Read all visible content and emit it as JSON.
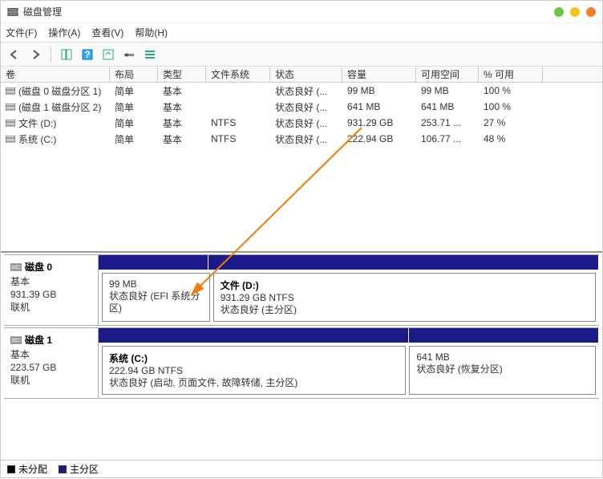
{
  "title": "磁盘管理",
  "menus": {
    "file": "文件(F)",
    "action": "操作(A)",
    "view": "查看(V)",
    "help": "帮助(H)"
  },
  "columns": {
    "volume": "卷",
    "layout": "布局",
    "type": "类型",
    "fs": "文件系统",
    "status": "状态",
    "capacity": "容量",
    "free": "可用空间",
    "pct": "% 可用"
  },
  "volumes": [
    {
      "name": "(磁盘 0 磁盘分区 1)",
      "layout": "简单",
      "type": "基本",
      "fs": "",
      "status": "状态良好 (...",
      "capacity": "99 MB",
      "free": "99 MB",
      "pct": "100 %"
    },
    {
      "name": "(磁盘 1 磁盘分区 2)",
      "layout": "简单",
      "type": "基本",
      "fs": "",
      "status": "状态良好 (...",
      "capacity": "641 MB",
      "free": "641 MB",
      "pct": "100 %"
    },
    {
      "name": "文件 (D:)",
      "layout": "简单",
      "type": "基本",
      "fs": "NTFS",
      "status": "状态良好 (...",
      "capacity": "931.29 GB",
      "free": "253.71 ...",
      "pct": "27 %"
    },
    {
      "name": "系统 (C:)",
      "layout": "简单",
      "type": "基本",
      "fs": "NTFS",
      "status": "状态良好 (...",
      "capacity": "222.94 GB",
      "free": "106.77 ...",
      "pct": "48 %"
    }
  ],
  "disks": [
    {
      "name": "磁盘 0",
      "type": "基本",
      "size": "931.39 GB",
      "status": "联机",
      "parts": [
        {
          "title": "",
          "size": "99 MB",
          "detail": "状态良好 (EFI 系统分区)",
          "widthPct": 22
        },
        {
          "title": "文件  (D:)",
          "size": "931.29 GB NTFS",
          "detail": "状态良好 (主分区)",
          "widthPct": 78
        }
      ]
    },
    {
      "name": "磁盘 1",
      "type": "基本",
      "size": "223.57 GB",
      "status": "联机",
      "parts": [
        {
          "title": "系统  (C:)",
          "size": "222.94 GB NTFS",
          "detail": "状态良好 (启动, 页面文件, 故障转储, 主分区)",
          "widthPct": 62
        },
        {
          "title": "",
          "size": "641 MB",
          "detail": "状态良好 (恢复分区)",
          "widthPct": 38
        }
      ]
    }
  ],
  "legend": {
    "unalloc": "未分配",
    "primary": "主分区"
  }
}
